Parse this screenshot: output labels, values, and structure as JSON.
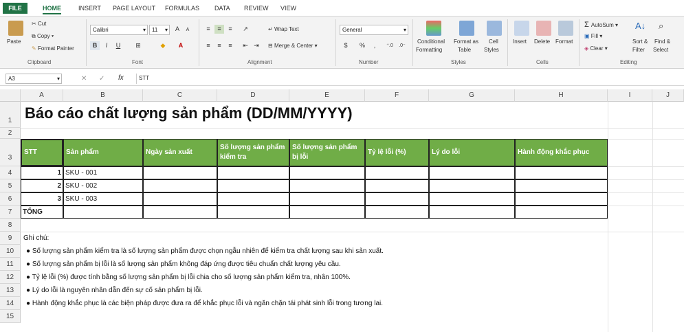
{
  "tabs": [
    "FILE",
    "HOME",
    "INSERT",
    "PAGE LAYOUT",
    "FORMULAS",
    "DATA",
    "REVIEW",
    "VIEW"
  ],
  "ribbon": {
    "clipboard": {
      "paste": "Paste",
      "cut": "Cut",
      "copy": "Copy",
      "format_painter": "Format Painter",
      "label": "Clipboard"
    },
    "font": {
      "name": "Calibri",
      "size": "11",
      "bold": "B",
      "italic": "I",
      "underline": "U",
      "grow": "A",
      "shrink": "A",
      "label": "Font"
    },
    "alignment": {
      "wrap_text": "Wrap Text",
      "merge_center": "Merge & Center",
      "label": "Alignment"
    },
    "number": {
      "format": "General",
      "currency": "$",
      "percent": "%",
      "comma": ",",
      "label": "Number"
    },
    "styles": {
      "conditional1": "Conditional",
      "conditional2": "Formatting",
      "format_as1": "Format as",
      "format_as2": "Table",
      "cell_styles1": "Cell",
      "cell_styles2": "Styles",
      "label": "Styles"
    },
    "cells": {
      "insert": "Insert",
      "delete": "Delete",
      "format": "Format",
      "label": "Cells"
    },
    "editing": {
      "autosum": "AutoSum",
      "fill": "Fill",
      "clear": "Clear",
      "sort1": "Sort &",
      "sort2": "Filter",
      "find1": "Find &",
      "find2": "Select",
      "label": "Editing"
    }
  },
  "formula_bar": {
    "name_box": "A3",
    "fx": "fx",
    "value": "STT"
  },
  "columns": [
    "A",
    "B",
    "C",
    "D",
    "E",
    "F",
    "G",
    "H",
    "I",
    "J"
  ],
  "rows": [
    "1",
    "2",
    "3",
    "4",
    "5",
    "6",
    "7",
    "8",
    "9",
    "10",
    "11",
    "12",
    "13",
    "14",
    "15"
  ],
  "sheet": {
    "title": "Báo cáo chất lượng sản phẩm (DD/MM/YYYY)",
    "headers": [
      "STT",
      "Sản phẩm",
      "Ngày sản xuất",
      "Số lượng sản phẩm kiểm tra",
      "Số lượng sản phẩm bị lỗi",
      "Tỷ lệ lỗi (%)",
      "Lý do lỗi",
      "Hành động khắc phục"
    ],
    "data_rows": [
      {
        "stt": "1",
        "product": "SKU - 001"
      },
      {
        "stt": "2",
        "product": "SKU - 002"
      },
      {
        "stt": "3",
        "product": "SKU - 003"
      }
    ],
    "total_label": "TỔNG",
    "notes_title": "Ghi chú:",
    "notes": [
      "● Số lượng sản phẩm kiểm tra là số lượng sản phẩm được chọn ngẫu nhiên để kiểm tra chất lượng sau khi sản xuất.",
      "● Số lượng sản phẩm bị lỗi là số lượng sản phẩm không đáp ứng được tiêu chuẩn chất lượng yêu cầu.",
      "● Tỷ lệ lỗi (%) được tính bằng số lượng sản phẩm bị lỗi chia cho số lượng sản phẩm kiểm tra, nhân 100%.",
      "● Lý do lỗi là nguyên nhân dẫn đến sự cố sản phẩm bị lỗi.",
      "● Hành động khắc phục là các biện pháp được đưa ra để khắc phục lỗi và ngăn chặn tái phát sinh lỗi trong tương lai."
    ]
  },
  "colors": {
    "accent": "#217346",
    "header_fill": "#70ad47"
  }
}
